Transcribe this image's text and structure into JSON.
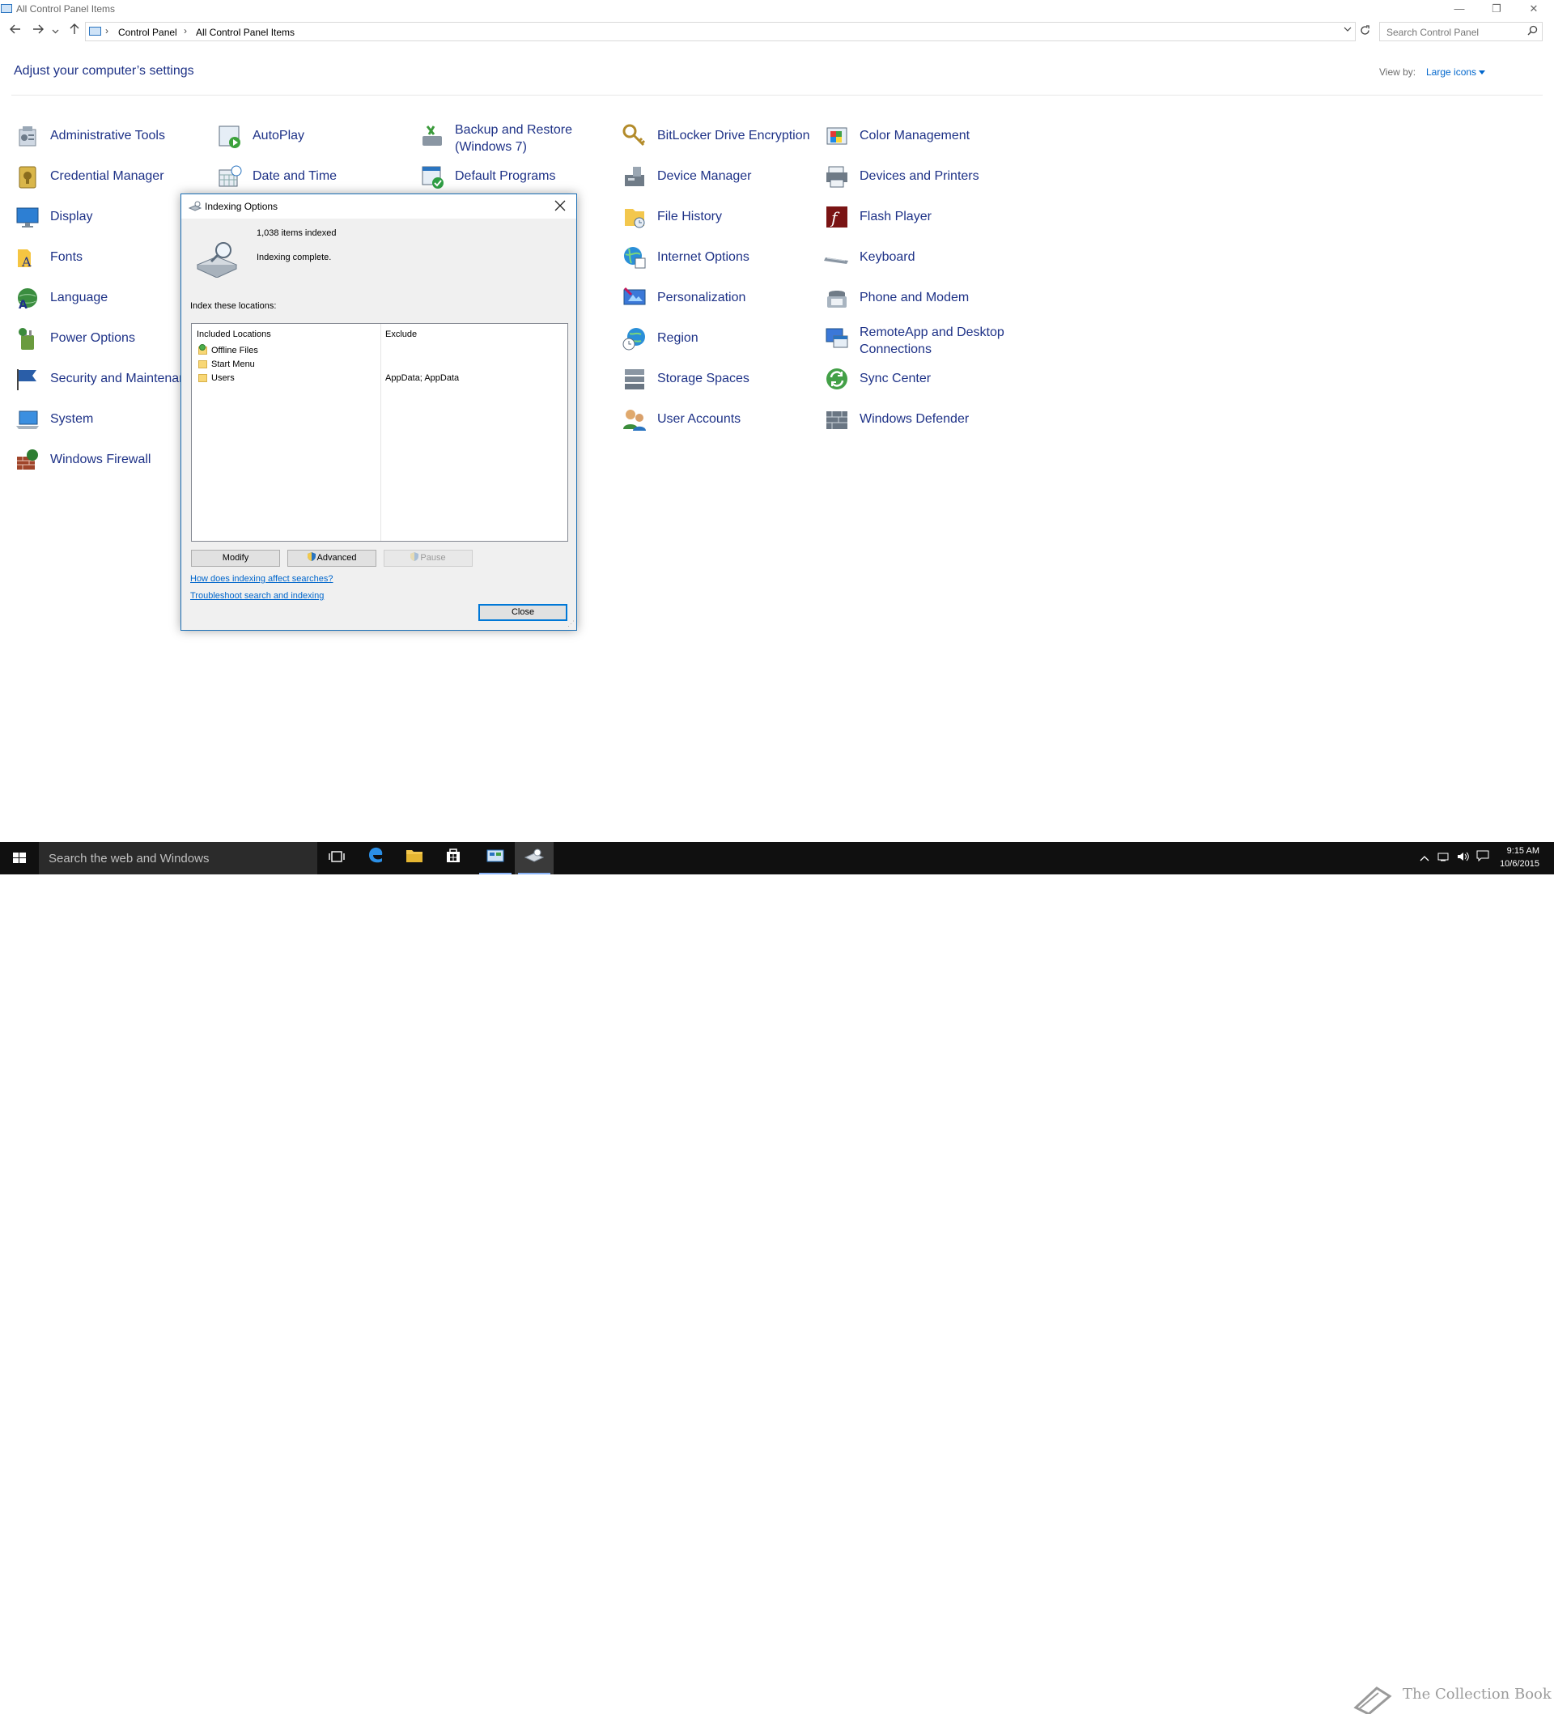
{
  "window": {
    "title": "All Control Panel Items",
    "minimize_glyph": "—",
    "restore_glyph": "❐",
    "close_glyph": "✕"
  },
  "navigation": {
    "back_icon": "arrow-left-icon",
    "forward_icon": "arrow-right-icon",
    "recent_icon": "chevron-down-icon",
    "up_icon": "arrow-up-icon",
    "breadcrumbs": [
      "Control Panel",
      "All Control Panel Items"
    ],
    "search_placeholder": "Search Control Panel"
  },
  "header": {
    "title": "Adjust your computer’s settings",
    "view_by_label": "View by:",
    "view_by_value": "Large icons"
  },
  "items": [
    {
      "label": "Administrative Tools",
      "icon": "admin-tools-icon"
    },
    {
      "label": "AutoPlay",
      "icon": "autoplay-icon"
    },
    {
      "label": "Backup and Restore (Windows 7)",
      "icon": "backup-icon"
    },
    {
      "label": "BitLocker Drive Encryption",
      "icon": "bitlocker-icon"
    },
    {
      "label": "Color Management",
      "icon": "color-management-icon"
    },
    {
      "label": "Credential Manager",
      "icon": "credential-manager-icon"
    },
    {
      "label": "Date and Time",
      "icon": "date-time-icon"
    },
    {
      "label": "Default Programs",
      "icon": "default-programs-icon"
    },
    {
      "label": "Device Manager",
      "icon": "device-manager-icon"
    },
    {
      "label": "Devices and Printers",
      "icon": "devices-printers-icon"
    },
    {
      "label": "Display",
      "icon": "display-icon"
    },
    {
      "label": "File History",
      "icon": "file-history-icon"
    },
    {
      "label": "Flash Player",
      "icon": "flash-player-icon"
    },
    {
      "label": "Fonts",
      "icon": "fonts-icon"
    },
    {
      "label": "Internet Options",
      "icon": "internet-options-icon"
    },
    {
      "label": "Keyboard",
      "icon": "keyboard-icon"
    },
    {
      "label": "Language",
      "icon": "language-icon"
    },
    {
      "label": "Personalization",
      "icon": "personalization-icon"
    },
    {
      "label": "Phone and Modem",
      "icon": "phone-modem-icon"
    },
    {
      "label": "Power Options",
      "icon": "power-options-icon"
    },
    {
      "label": "Region",
      "icon": "region-icon"
    },
    {
      "label": "RemoteApp and Desktop Connections",
      "icon": "remoteapp-icon"
    },
    {
      "label": "Security and Maintenar",
      "icon": "security-maintenance-icon"
    },
    {
      "label": "Storage Spaces",
      "icon": "storage-spaces-icon"
    },
    {
      "label": "Sync Center",
      "icon": "sync-center-icon"
    },
    {
      "label": "System",
      "icon": "system-icon"
    },
    {
      "label": "User Accounts",
      "icon": "user-accounts-icon"
    },
    {
      "label": "Windows Defender",
      "icon": "windows-defender-icon"
    },
    {
      "label": "Windows Firewall",
      "icon": "windows-firewall-icon"
    }
  ],
  "dialog": {
    "title": "Indexing Options",
    "items_indexed": "1,038 items indexed",
    "status": "Indexing complete.",
    "index_label": "Index these locations:",
    "columns": [
      "Included Locations",
      "Exclude"
    ],
    "locations": [
      {
        "name": "Offline Files",
        "exclude": ""
      },
      {
        "name": "Start Menu",
        "exclude": ""
      },
      {
        "name": "Users",
        "exclude": "AppData; AppData"
      }
    ],
    "buttons": {
      "modify": "Modify",
      "advanced": "Advanced",
      "pause": "Pause",
      "close": "Close"
    },
    "links": [
      "How does indexing affect searches?",
      "Troubleshoot search and indexing"
    ]
  },
  "taskbar": {
    "search_placeholder": "Search the web and Windows",
    "time": "9:15 AM",
    "date": "10/6/2015"
  },
  "watermark": "The Collection Book",
  "colors": {
    "link_blue": "#1e3287",
    "accent": "#0078d7",
    "taskbar": "#101010"
  }
}
